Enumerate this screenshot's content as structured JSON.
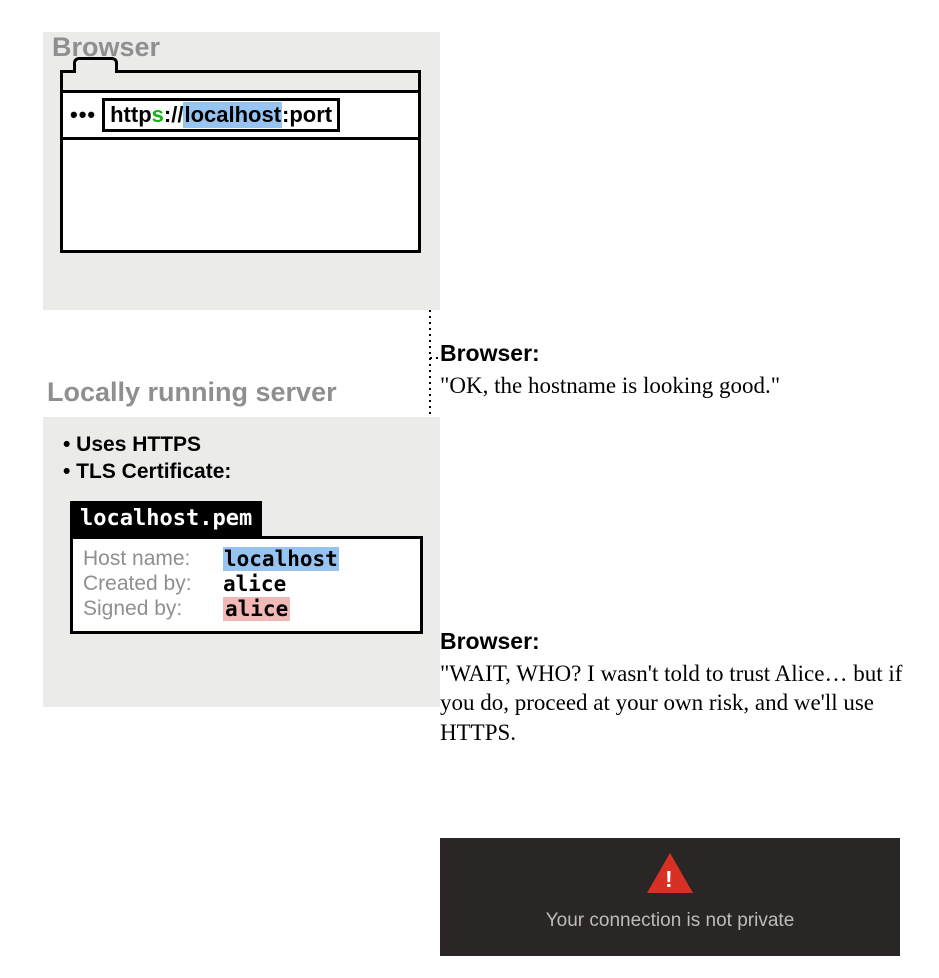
{
  "browser": {
    "title": "Browser",
    "more_icon": "•••",
    "url": {
      "scheme_http": "http",
      "scheme_s": "s",
      "sep": "://",
      "host": "localhost",
      "port_sep": ":",
      "port": "port"
    }
  },
  "server": {
    "title": "Locally running server",
    "bullets": [
      "• Uses HTTPS",
      "• TLS Certificate:"
    ],
    "cert_file": "localhost.pem",
    "rows": [
      {
        "key": "Host name:",
        "val": "localhost",
        "highlight": "blue"
      },
      {
        "key": "Created by:",
        "val": "alice",
        "highlight": "none"
      },
      {
        "key": "Signed by:",
        "val": "alice",
        "highlight": "red"
      }
    ]
  },
  "annotations": {
    "a1": {
      "speaker": "Browser:",
      "text": "\"OK, the hostname is looking good.\""
    },
    "a2": {
      "speaker": "Browser:",
      "text": "\"WAIT, WHO? I wasn't told to trust Alice… but if you do, proceed at your own risk, and we'll use HTTPS."
    }
  },
  "error": {
    "text": "Your connection is not private"
  }
}
